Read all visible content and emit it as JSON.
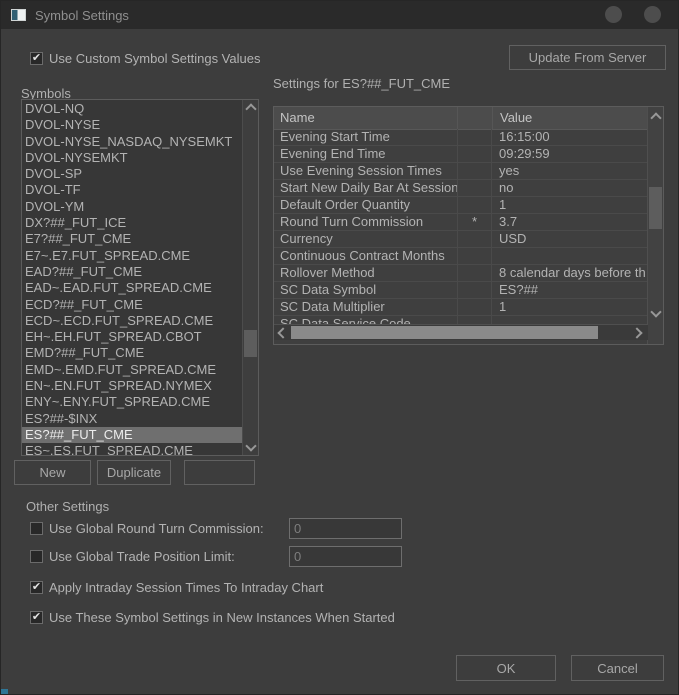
{
  "window": {
    "title": "Symbol Settings"
  },
  "top": {
    "use_custom": {
      "label": "Use Custom Symbol Settings Values",
      "checked": true
    },
    "update_from_server": "Update From Server"
  },
  "symbols": {
    "label": "Symbols",
    "selected_index": 20,
    "items": [
      "DVOL-NQ",
      "DVOL-NYSE",
      "DVOL-NYSE_NASDAQ_NYSEMKT",
      "DVOL-NYSEMKT",
      "DVOL-SP",
      "DVOL-TF",
      "DVOL-YM",
      "DX?##_FUT_ICE",
      "E7?##_FUT_CME",
      "E7~.E7.FUT_SPREAD.CME",
      "EAD?##_FUT_CME",
      "EAD~.EAD.FUT_SPREAD.CME",
      "ECD?##_FUT_CME",
      "ECD~.ECD.FUT_SPREAD.CME",
      "EH~.EH.FUT_SPREAD.CBOT",
      "EMD?##_FUT_CME",
      "EMD~.EMD.FUT_SPREAD.CME",
      "EN~.EN.FUT_SPREAD.NYMEX",
      "ENY~.ENY.FUT_SPREAD.CME",
      "ES?##-$INX",
      "ES?##_FUT_CME",
      "ES~.ES.FUT_SPREAD.CME"
    ]
  },
  "symbol_buttons": {
    "new": "New",
    "duplicate": "Duplicate",
    "blank": ""
  },
  "settings": {
    "title": "Settings for ES?##_FUT_CME",
    "columns": {
      "name": "Name",
      "value": "Value"
    },
    "rows": [
      {
        "name": "Evening Start Time",
        "flag": "",
        "value": "16:15:00"
      },
      {
        "name": "Evening End Time",
        "flag": "",
        "value": "09:29:59"
      },
      {
        "name": "Use Evening Session Times",
        "flag": "",
        "value": "yes"
      },
      {
        "name": "Start New Daily Bar At Session...",
        "flag": "",
        "value": "no"
      },
      {
        "name": "Default Order Quantity",
        "flag": "",
        "value": "1"
      },
      {
        "name": "Round Turn Commission",
        "flag": "*",
        "value": "3.7"
      },
      {
        "name": "Currency",
        "flag": "",
        "value": "USD"
      },
      {
        "name": "Continuous Contract Months",
        "flag": "",
        "value": ""
      },
      {
        "name": "Rollover Method",
        "flag": "",
        "value": "8 calendar days before th"
      },
      {
        "name": "SC Data Symbol",
        "flag": "",
        "value": "ES?##"
      },
      {
        "name": "SC Data Multiplier",
        "flag": "",
        "value": "1"
      },
      {
        "name": "SC Data Service Code",
        "flag": "",
        "value": "",
        "partial": true
      }
    ]
  },
  "other_settings": {
    "label": "Other Settings",
    "rows": [
      {
        "label": "Use Global Round Turn Commission:",
        "checked": false,
        "input": "0"
      },
      {
        "label": "Use Global Trade Position Limit:",
        "checked": false,
        "input": "0"
      },
      {
        "label": "Apply Intraday Session Times To Intraday Chart",
        "checked": true
      },
      {
        "label": "Use These Symbol Settings in New Instances When Started",
        "checked": true
      }
    ]
  },
  "footer": {
    "ok": "OK",
    "cancel": "Cancel"
  },
  "icons": {
    "checkmark": "✔"
  },
  "colors": {
    "background": "#3d3d3d",
    "titlebar": "#2a2a2a",
    "selection": "#6f6f6f",
    "row_separator": "#4a4a4a",
    "corner_accent": "#2f7696"
  }
}
